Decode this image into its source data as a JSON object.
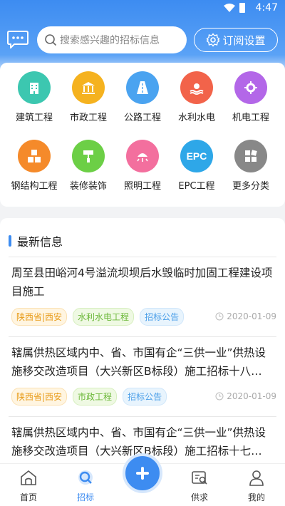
{
  "status_bar": {
    "time": "4:47"
  },
  "search": {
    "placeholder": "搜索感兴趣的招标信息"
  },
  "subscribe": {
    "label": "订阅设置"
  },
  "categories": [
    {
      "label": "建筑工程",
      "color": "#3cc7b0",
      "icon": "building-icon"
    },
    {
      "label": "市政工程",
      "color": "#f5b21f",
      "icon": "government-icon"
    },
    {
      "label": "公路工程",
      "color": "#4aa3f0",
      "icon": "road-icon"
    },
    {
      "label": "水利水电",
      "color": "#f2634a",
      "icon": "hydro-icon"
    },
    {
      "label": "机电工程",
      "color": "#b367e8",
      "icon": "gear-icon"
    },
    {
      "label": "钢结构工程",
      "color": "#f58a2a",
      "icon": "cubes-icon"
    },
    {
      "label": "装修装饰",
      "color": "#6ccf46",
      "icon": "paint-roller-icon"
    },
    {
      "label": "照明工程",
      "color": "#f36f9e",
      "icon": "lamp-icon"
    },
    {
      "label": "EPC工程",
      "color": "#2ea7e8",
      "icon": "epc-icon"
    },
    {
      "label": "更多分类",
      "color": "#888888",
      "icon": "grid-icon"
    }
  ],
  "news": {
    "heading": "最新信息",
    "items": [
      {
        "title": "周至县田峪河4号溢流坝坝后水毁临时加固工程建设项目施工",
        "tags": [
          "陕西省|西安",
          "水利水电工程",
          "招标公告"
        ],
        "date": "2020-01-09"
      },
      {
        "title": "辖属供热区域内中、省、市国有企“三供一业”供热设施移交改造项目（大兴新区B标段）施工招标十八…",
        "tags": [
          "陕西省|西安",
          "市政工程",
          "招标公告"
        ],
        "date": "2020-01-09"
      },
      {
        "title": "辖属供热区域内中、省、市国有企“三供一业”供热设施移交改造项目（大兴新区B标段）施工招标十七…",
        "tags": [],
        "date": ""
      }
    ]
  },
  "nav": {
    "home": "首页",
    "bidding": "招标",
    "demand": "供求",
    "mine": "我的"
  }
}
